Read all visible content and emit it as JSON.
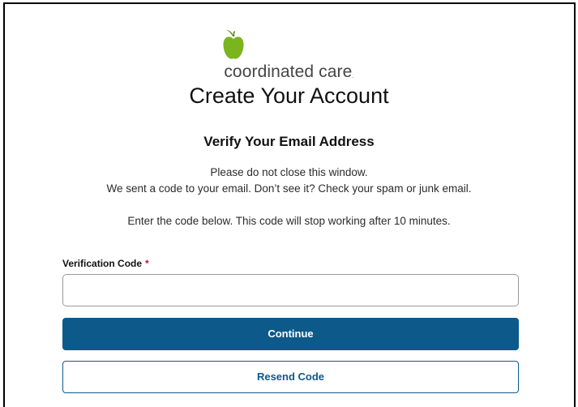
{
  "brand": {
    "name": "coordinated care",
    "trademark": ".",
    "logo_icon": "apple-icon",
    "apple_color": "#7ab41f",
    "leaf_color": "#5e9a1c"
  },
  "page": {
    "title": "Create Your Account",
    "section_title": "Verify Your Email Address",
    "message_line1": "Please do not close this window.",
    "message_line2": "We sent a code to your email. Don’t see it? Check your spam or junk email.",
    "message_line3": "Enter the code below. This code will stop working after 10 minutes."
  },
  "form": {
    "code_label": "Verification Code",
    "required_marker": "*",
    "code_value": "",
    "continue_label": "Continue",
    "resend_label": "Resend Code"
  },
  "colors": {
    "primary": "#0d5a8a",
    "required": "#c8102e"
  }
}
